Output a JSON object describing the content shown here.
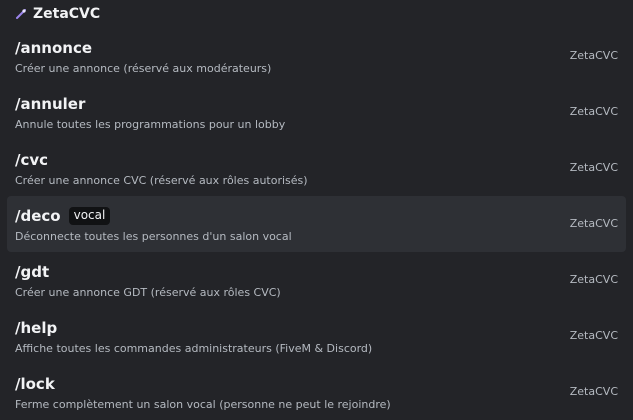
{
  "header": {
    "app_name": "ZetaCVC",
    "icon": "bot-app-icon"
  },
  "commands": [
    {
      "name": "/annonce",
      "option": "",
      "description": "Créer une annonce (réservé aux modérateurs)",
      "source": "ZetaCVC"
    },
    {
      "name": "/annuler",
      "option": "",
      "description": "Annule toutes les programmations pour un lobby",
      "source": "ZetaCVC"
    },
    {
      "name": "/cvc",
      "option": "",
      "description": "Créer une annonce CVC (réservé aux rôles autorisés)",
      "source": "ZetaCVC"
    },
    {
      "name": "/deco",
      "option": "vocal",
      "description": "Déconnecte toutes les personnes d'un salon vocal",
      "source": "ZetaCVC",
      "selected": true
    },
    {
      "name": "/gdt",
      "option": "",
      "description": "Créer une annonce GDT (réservé aux rôles CVC)",
      "source": "ZetaCVC"
    },
    {
      "name": "/help",
      "option": "",
      "description": "Affiche toutes les commandes administrateurs (FiveM & Discord)",
      "source": "ZetaCVC"
    },
    {
      "name": "/lock",
      "option": "",
      "description": "Ferme complètement un salon vocal (personne ne peut le rejoindre)",
      "source": "ZetaCVC"
    }
  ],
  "colors": {
    "background": "#232428",
    "selected_row": "#2e3035",
    "option_badge": "#111214"
  }
}
